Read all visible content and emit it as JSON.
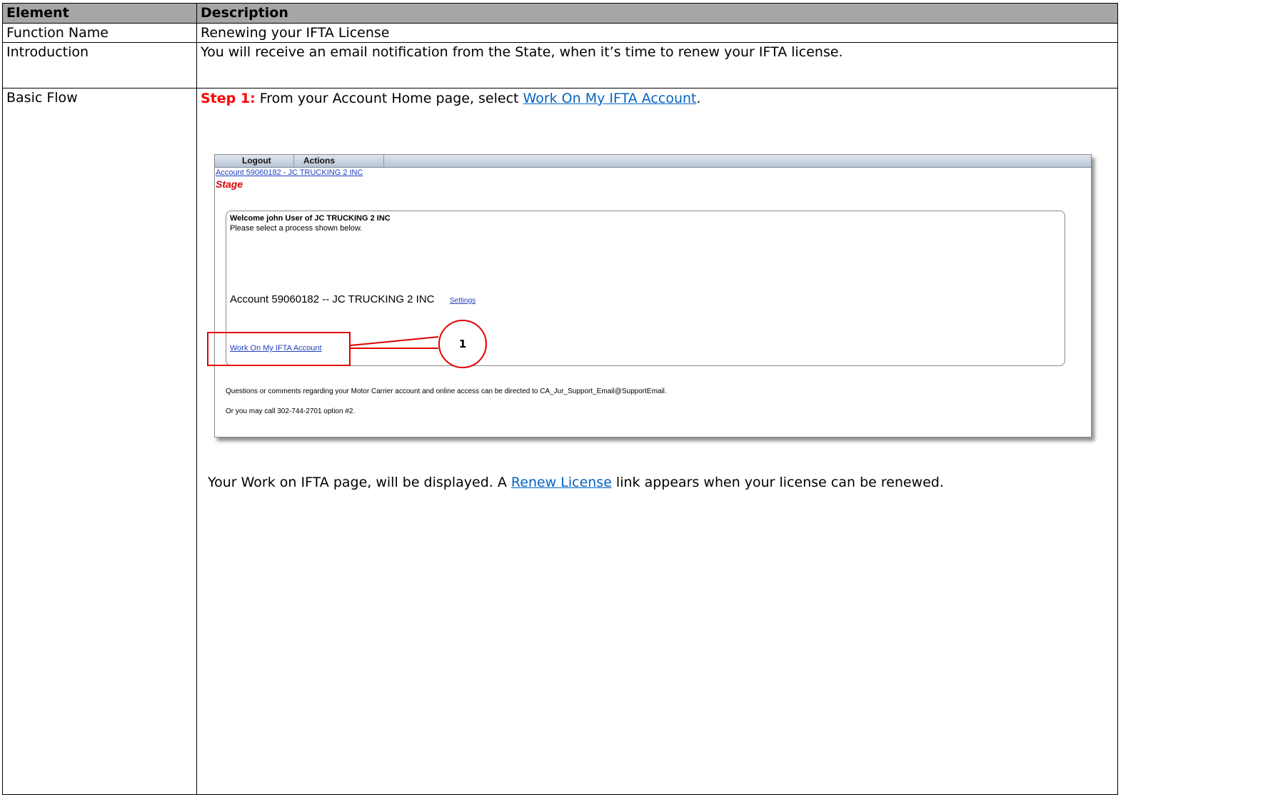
{
  "table": {
    "header": {
      "element": "Element",
      "description": "Description"
    },
    "rows": [
      {
        "element": "Function Name",
        "description": "Renewing your IFTA License"
      },
      {
        "element": "Introduction",
        "description": "You will receive an email notification from the State, when it’s time to renew your IFTA license."
      },
      {
        "element": "Basic Flow"
      }
    ]
  },
  "step1": {
    "label": "Step 1:",
    "text_before": " From your Account Home page, select ",
    "link": "Work On My IFTA Account",
    "text_after": "."
  },
  "screenshot": {
    "menu": {
      "logout": "Logout",
      "actions": "Actions"
    },
    "account_link": "Account 59060182 - JC TRUCKING 2 INC",
    "stage": "Stage",
    "welcome": "Welcome john User of JC TRUCKING 2 INC",
    "select_process": "Please select a process shown below.",
    "account_title": "Account 59060182 -- JC TRUCKING 2 INC",
    "settings": "Settings",
    "work_link": "Work On My IFTA Account",
    "questions": "Questions or comments regarding your Motor Carrier account and online access can be directed to CA_Jur_Support_Email@SupportEmail.",
    "call": "Or you may call 302-744-2701 option #2.",
    "callout_number": "1",
    "callout_color": "#e00000"
  },
  "after": {
    "text_before": "Your Work on IFTA page, will be displayed.   A ",
    "link": "Renew License",
    "text_after": " link appears when your license can be renewed."
  }
}
